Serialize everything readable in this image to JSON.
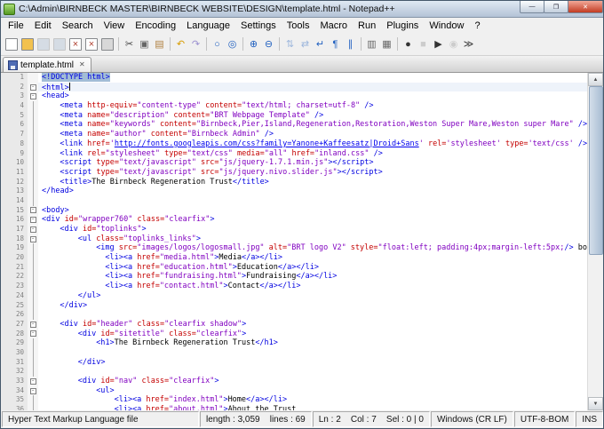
{
  "colors": {
    "tag": "#0000e0",
    "attr": "#c40000",
    "val": "#8000c0",
    "txt": "#000000",
    "url": "#0000ee",
    "selection": "#a2bdd6",
    "cur": "#eef3fa"
  },
  "window": {
    "title": "C:\\Admin\\BIRNBECK MASTER\\BIRNBECK WEBSITE\\DESIGN\\template.html - Notepad++",
    "controls": {
      "minimize": "—",
      "maximize": "❐",
      "close": "✕"
    }
  },
  "menubar": [
    "File",
    "Edit",
    "Search",
    "View",
    "Encoding",
    "Language",
    "Settings",
    "Tools",
    "Macro",
    "Run",
    "Plugins",
    "Window",
    "?"
  ],
  "toolbar": [
    {
      "name": "new-file-icon",
      "glyph": "",
      "bg": "#ffffff"
    },
    {
      "name": "open-folder-icon",
      "glyph": "",
      "bg": "#f2c14e"
    },
    {
      "name": "save-icon",
      "glyph": "",
      "bg": "#aebfd4",
      "disabled": true
    },
    {
      "name": "save-all-icon",
      "glyph": "",
      "bg": "#aebfd4",
      "disabled": true
    },
    {
      "name": "close-file-icon",
      "glyph": "×",
      "color": "#b04030",
      "bg": "#ffffff"
    },
    {
      "name": "close-all-icon",
      "glyph": "×",
      "color": "#b04030",
      "bg": "#ffffff"
    },
    {
      "name": "print-icon",
      "glyph": "",
      "bg": "#d8d8d8"
    },
    {
      "sep": true
    },
    {
      "name": "cut-icon",
      "glyph": "✂",
      "color": "#444444"
    },
    {
      "name": "copy-icon",
      "glyph": "▣",
      "color": "#666666"
    },
    {
      "name": "paste-icon",
      "glyph": "▤",
      "color": "#b08040"
    },
    {
      "sep": true
    },
    {
      "name": "undo-icon",
      "glyph": "↶",
      "color": "#d89c00"
    },
    {
      "name": "redo-icon",
      "glyph": "↷",
      "color": "#9a8fd0"
    },
    {
      "sep": true
    },
    {
      "name": "find-icon",
      "glyph": "○",
      "color": "#2060c0"
    },
    {
      "name": "replace-icon",
      "glyph": "◎",
      "color": "#2060c0"
    },
    {
      "sep": true
    },
    {
      "name": "zoom-in-icon",
      "glyph": "⊕",
      "color": "#2060c0"
    },
    {
      "name": "zoom-out-icon",
      "glyph": "⊖",
      "color": "#2060c0"
    },
    {
      "sep": true
    },
    {
      "name": "sync-vertical-icon",
      "glyph": "⇅",
      "color": "#2060c0",
      "disabled": true
    },
    {
      "name": "sync-horizontal-icon",
      "glyph": "⇄",
      "color": "#2060c0",
      "disabled": true
    },
    {
      "name": "word-wrap-icon",
      "glyph": "↵",
      "color": "#2060c0"
    },
    {
      "name": "show-all-chars-icon",
      "glyph": "¶",
      "color": "#2060c0"
    },
    {
      "name": "indent-guide-icon",
      "glyph": "∥",
      "color": "#2060c0"
    },
    {
      "sep": true
    },
    {
      "name": "user-dialog-icon",
      "glyph": "▥",
      "color": "#666666"
    },
    {
      "name": "doc-map-icon",
      "glyph": "▦",
      "color": "#666666"
    },
    {
      "sep": true
    },
    {
      "name": "record-macro-icon",
      "glyph": "●",
      "color": "#333333"
    },
    {
      "name": "stop-macro-icon",
      "glyph": "■",
      "color": "#999999",
      "disabled": true
    },
    {
      "name": "play-macro-icon",
      "glyph": "▶",
      "color": "#333333"
    },
    {
      "name": "save-macro-icon",
      "glyph": "◉",
      "color": "#999999",
      "disabled": true
    },
    {
      "name": "run-macro-icon",
      "glyph": "≫",
      "color": "#333333"
    }
  ],
  "tabbar": {
    "tabs": [
      {
        "label": "template.html",
        "active": true,
        "close_glyph": "✕"
      }
    ]
  },
  "editor": {
    "lines": [
      {
        "n": 1,
        "segs": [
          [
            "tag",
            "<!DOCTYPE html>",
            "sel"
          ]
        ]
      },
      {
        "n": 2,
        "fold": "box",
        "current": true,
        "caret": true,
        "segs": [
          [
            "tag",
            "<html>"
          ]
        ]
      },
      {
        "n": 3,
        "fold": "box",
        "segs": [
          [
            "tag",
            "<head>"
          ]
        ]
      },
      {
        "n": 4,
        "fold": "line",
        "ind": 4,
        "segs": [
          [
            "tag",
            "<meta "
          ],
          [
            "attr",
            "http-equiv="
          ],
          [
            "val",
            "\"content-type\""
          ],
          [
            "attr",
            " content="
          ],
          [
            "val",
            "\"text/html; charset=utf-8\""
          ],
          [
            "tag",
            " />"
          ]
        ]
      },
      {
        "n": 5,
        "fold": "line",
        "ind": 4,
        "segs": [
          [
            "tag",
            "<meta "
          ],
          [
            "attr",
            "name="
          ],
          [
            "val",
            "\"description\""
          ],
          [
            "attr",
            " content="
          ],
          [
            "val",
            "\"BRT Webpage Template\""
          ],
          [
            "tag",
            " />"
          ]
        ]
      },
      {
        "n": 6,
        "fold": "line",
        "ind": 4,
        "segs": [
          [
            "tag",
            "<meta "
          ],
          [
            "attr",
            "name="
          ],
          [
            "val",
            "\"keywords\""
          ],
          [
            "attr",
            " content="
          ],
          [
            "val",
            "\"Birnbeck,Pier,Island,Regeneration,Restoration,Weston Super Mare,Weston super Mare\""
          ],
          [
            "tag",
            " />"
          ]
        ]
      },
      {
        "n": 7,
        "fold": "line",
        "ind": 4,
        "segs": [
          [
            "tag",
            "<meta "
          ],
          [
            "attr",
            "name="
          ],
          [
            "val",
            "\"author\""
          ],
          [
            "attr",
            " content="
          ],
          [
            "val",
            "\"Birnbeck Admin\""
          ],
          [
            "tag",
            " />"
          ]
        ]
      },
      {
        "n": 8,
        "fold": "line",
        "ind": 4,
        "segs": [
          [
            "tag",
            "<link "
          ],
          [
            "attr",
            "href="
          ],
          [
            "val",
            "'"
          ],
          [
            "url",
            "http://fonts.googleapis.com/css?family=Yanone+Kaffeesatz|Droid+Sans"
          ],
          [
            "val",
            "'"
          ],
          [
            "attr",
            " rel="
          ],
          [
            "val",
            "'stylesheet'"
          ],
          [
            "attr",
            " type="
          ],
          [
            "val",
            "'text/css'"
          ],
          [
            "tag",
            " />"
          ]
        ]
      },
      {
        "n": 9,
        "fold": "line",
        "ind": 4,
        "segs": [
          [
            "tag",
            "<link "
          ],
          [
            "attr",
            "rel="
          ],
          [
            "val",
            "\"stylesheet\""
          ],
          [
            "attr",
            " type="
          ],
          [
            "val",
            "\"text/css\""
          ],
          [
            "attr",
            " media="
          ],
          [
            "val",
            "\"all\""
          ],
          [
            "attr",
            " href="
          ],
          [
            "val",
            "\"inland.css\""
          ],
          [
            "tag",
            " />"
          ]
        ]
      },
      {
        "n": 10,
        "fold": "line",
        "ind": 4,
        "segs": [
          [
            "tag",
            "<script "
          ],
          [
            "attr",
            "type="
          ],
          [
            "val",
            "\"text/javascript\""
          ],
          [
            "attr",
            " src="
          ],
          [
            "val",
            "\"js/jquery-1.7.1.min.js\""
          ],
          [
            "tag",
            "></script>"
          ]
        ]
      },
      {
        "n": 11,
        "fold": "line",
        "ind": 4,
        "segs": [
          [
            "tag",
            "<script "
          ],
          [
            "attr",
            "type="
          ],
          [
            "val",
            "\"text/javascript\""
          ],
          [
            "attr",
            " src="
          ],
          [
            "val",
            "\"js/jquery.nivo.slider.js\""
          ],
          [
            "tag",
            "></script>"
          ]
        ]
      },
      {
        "n": 12,
        "fold": "line",
        "ind": 4,
        "segs": [
          [
            "tag",
            "<title>"
          ],
          [
            "txt",
            "The Birnbeck Regeneration Trust"
          ],
          [
            "tag",
            "</title>"
          ]
        ]
      },
      {
        "n": 13,
        "fold": "line",
        "segs": [
          [
            "tag",
            "</head>"
          ]
        ]
      },
      {
        "n": 14,
        "fold": "line",
        "segs": []
      },
      {
        "n": 15,
        "fold": "box",
        "segs": [
          [
            "tag",
            "<body>"
          ]
        ]
      },
      {
        "n": 16,
        "fold": "box",
        "segs": [
          [
            "tag",
            "<div "
          ],
          [
            "attr",
            "id="
          ],
          [
            "val",
            "\"wrapper760\""
          ],
          [
            "attr",
            " class="
          ],
          [
            "val",
            "\"clearfix\""
          ],
          [
            "tag",
            ">"
          ]
        ]
      },
      {
        "n": 17,
        "fold": "box",
        "ind": 4,
        "segs": [
          [
            "tag",
            "<div "
          ],
          [
            "attr",
            "id="
          ],
          [
            "val",
            "\"toplinks\""
          ],
          [
            "tag",
            ">"
          ]
        ]
      },
      {
        "n": 18,
        "fold": "box",
        "ind": 8,
        "segs": [
          [
            "tag",
            "<ul "
          ],
          [
            "attr",
            "class="
          ],
          [
            "val",
            "\"toplinks_links\""
          ],
          [
            "tag",
            ">"
          ]
        ]
      },
      {
        "n": 19,
        "fold": "line",
        "ind": 12,
        "segs": [
          [
            "tag",
            "<img "
          ],
          [
            "attr",
            "src="
          ],
          [
            "val",
            "\"images/logos/logosmall.jpg\""
          ],
          [
            "attr",
            " alt="
          ],
          [
            "val",
            "\"BRT logo V2\""
          ],
          [
            "attr",
            " style="
          ],
          [
            "val",
            "\"float:left; padding:4px;margin-left:5px;"
          ],
          [
            "tag",
            "/>"
          ],
          [
            "txt",
            " border:none;\""
          ]
        ]
      },
      {
        "n": 20,
        "fold": "line",
        "ind": 14,
        "segs": [
          [
            "tag",
            "<li><a "
          ],
          [
            "attr",
            "href="
          ],
          [
            "val",
            "\"media.html\""
          ],
          [
            "tag",
            ">"
          ],
          [
            "txt",
            "Media"
          ],
          [
            "tag",
            "</a></li>"
          ]
        ]
      },
      {
        "n": 21,
        "fold": "line",
        "ind": 14,
        "segs": [
          [
            "tag",
            "<li><a "
          ],
          [
            "attr",
            "href="
          ],
          [
            "val",
            "\"education.html\""
          ],
          [
            "tag",
            ">"
          ],
          [
            "txt",
            "Education"
          ],
          [
            "tag",
            "</a></li>"
          ]
        ]
      },
      {
        "n": 22,
        "fold": "line",
        "ind": 14,
        "segs": [
          [
            "tag",
            "<li><a "
          ],
          [
            "attr",
            "href="
          ],
          [
            "val",
            "\"fundraising.html\""
          ],
          [
            "tag",
            ">"
          ],
          [
            "txt",
            "Fundraising"
          ],
          [
            "tag",
            "</a></li>"
          ]
        ]
      },
      {
        "n": 23,
        "fold": "line",
        "ind": 14,
        "segs": [
          [
            "tag",
            "<li><a "
          ],
          [
            "attr",
            "href="
          ],
          [
            "val",
            "\"contact.html\""
          ],
          [
            "tag",
            ">"
          ],
          [
            "txt",
            "Contact"
          ],
          [
            "tag",
            "</a></li>"
          ]
        ]
      },
      {
        "n": 24,
        "fold": "line",
        "ind": 8,
        "segs": [
          [
            "tag",
            "</ul>"
          ]
        ]
      },
      {
        "n": 25,
        "fold": "line",
        "ind": 4,
        "segs": [
          [
            "tag",
            "</div>"
          ]
        ]
      },
      {
        "n": 26,
        "fold": "line",
        "segs": []
      },
      {
        "n": 27,
        "fold": "box",
        "ind": 4,
        "segs": [
          [
            "tag",
            "<div "
          ],
          [
            "attr",
            "id="
          ],
          [
            "val",
            "\"header\""
          ],
          [
            "attr",
            " class="
          ],
          [
            "val",
            "\"clearfix shadow\""
          ],
          [
            "tag",
            ">"
          ]
        ]
      },
      {
        "n": 28,
        "fold": "box",
        "ind": 8,
        "segs": [
          [
            "tag",
            "<div "
          ],
          [
            "attr",
            "id="
          ],
          [
            "val",
            "\"sitetitle\""
          ],
          [
            "attr",
            " class="
          ],
          [
            "val",
            "\"clearfix\""
          ],
          [
            "tag",
            ">"
          ]
        ]
      },
      {
        "n": 29,
        "fold": "line",
        "ind": 12,
        "segs": [
          [
            "tag",
            "<h1>"
          ],
          [
            "txt",
            "The Birnbeck Regeneration Trust"
          ],
          [
            "tag",
            "</h1>"
          ]
        ]
      },
      {
        "n": 30,
        "fold": "line",
        "segs": []
      },
      {
        "n": 31,
        "fold": "line",
        "ind": 8,
        "segs": [
          [
            "tag",
            "</div>"
          ]
        ]
      },
      {
        "n": 32,
        "fold": "line",
        "segs": []
      },
      {
        "n": 33,
        "fold": "box",
        "ind": 8,
        "segs": [
          [
            "tag",
            "<div "
          ],
          [
            "attr",
            "id="
          ],
          [
            "val",
            "\"nav\""
          ],
          [
            "attr",
            " class="
          ],
          [
            "val",
            "\"clearfix\""
          ],
          [
            "tag",
            ">"
          ]
        ]
      },
      {
        "n": 34,
        "fold": "box",
        "ind": 12,
        "segs": [
          [
            "tag",
            "<ul>"
          ]
        ]
      },
      {
        "n": 35,
        "fold": "line",
        "ind": 16,
        "segs": [
          [
            "tag",
            "<li><a "
          ],
          [
            "attr",
            "href="
          ],
          [
            "val",
            "\"index.html\""
          ],
          [
            "tag",
            ">"
          ],
          [
            "txt",
            "Home"
          ],
          [
            "tag",
            "</a></li>"
          ]
        ]
      },
      {
        "n": 36,
        "fold": "line",
        "ind": 16,
        "segs": [
          [
            "tag",
            "<li><a "
          ],
          [
            "attr",
            "href="
          ],
          [
            "val",
            "\"about.html\""
          ],
          [
            "tag",
            ">"
          ],
          [
            "txt",
            "About the Trust"
          ]
        ]
      }
    ]
  },
  "statusbar": {
    "doctype": "Hyper Text Markup Language file",
    "length_lines": "length : 3,059    lines : 69",
    "position": "Ln : 2    Col : 7    Sel : 0 | 0",
    "eol": "Windows (CR LF)",
    "encoding": "UTF-8-BOM",
    "insert_mode": "INS"
  }
}
